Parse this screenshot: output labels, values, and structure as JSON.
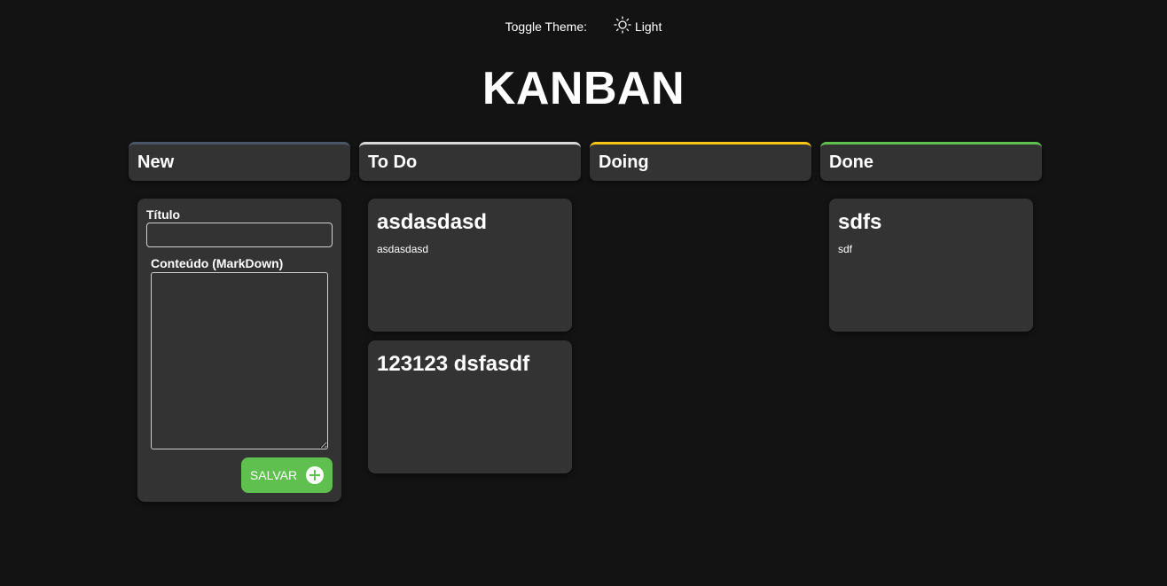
{
  "theme": {
    "toggle_label": "Toggle Theme:",
    "mode_label": "Light",
    "icon": "sun-icon"
  },
  "app": {
    "title": "KANBAN"
  },
  "colors": {
    "background": "#131313",
    "column_bg": "#333333",
    "new_accent": "#4a5568",
    "todo_accent": "#d9d9d9",
    "doing_accent": "#f5c518",
    "done_accent": "#5fbf4f",
    "save_button": "#5fbf4f"
  },
  "columns": [
    {
      "title": "New"
    },
    {
      "title": "To Do"
    },
    {
      "title": "Doing"
    },
    {
      "title": "Done"
    }
  ],
  "form": {
    "title_label": "Título",
    "title_value": "",
    "content_label": "Conteúdo (MarkDown)",
    "content_value": "",
    "save_label": "SALVAR",
    "save_icon": "plus-circle-icon"
  },
  "cards": {
    "todo": [
      {
        "title": "asdasdasd",
        "content": "asdasdasd"
      },
      {
        "title": "123123 dsfasdf",
        "content": ""
      }
    ],
    "doing": [],
    "done": [
      {
        "title": "sdfs",
        "content": "sdf"
      }
    ]
  }
}
